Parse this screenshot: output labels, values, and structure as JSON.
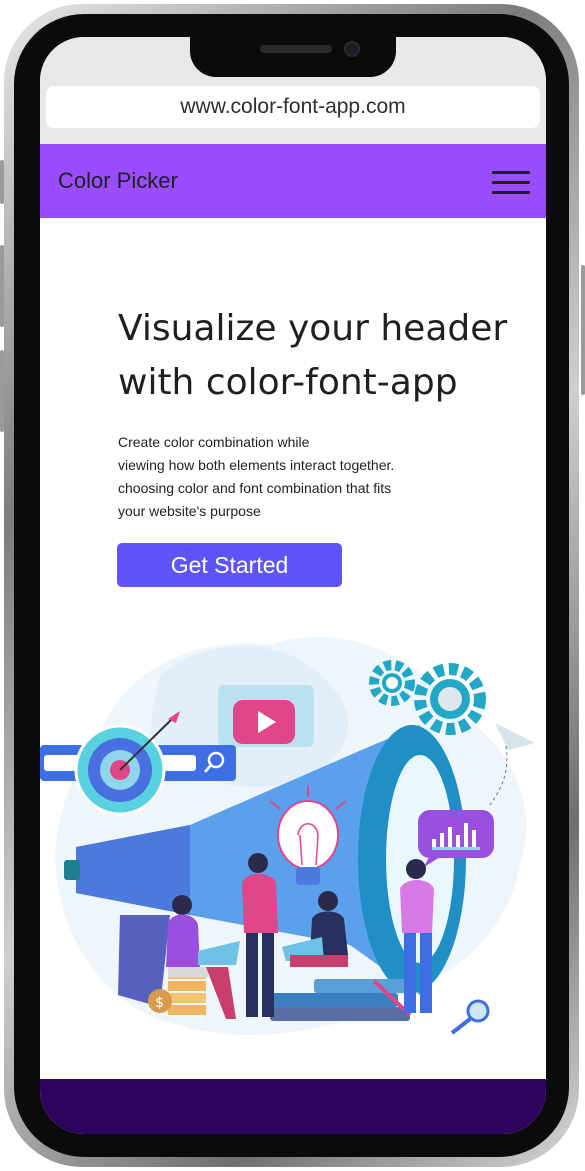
{
  "browser": {
    "url": "www.color-font-app.com"
  },
  "header": {
    "brand": "Color Picker",
    "menu_icon": "hamburger-icon"
  },
  "hero": {
    "title_line1": "Visualize your header",
    "title_line2": "with color-font-app",
    "description": [
      "Create color combination while",
      "viewing how both elements interact together.",
      "choosing color and font combination that fits",
      "your website's purpose"
    ],
    "cta_label": "Get Started"
  },
  "colors": {
    "header": "#9a4dff",
    "cta": "#5e54fa",
    "footer": "#2e035e"
  }
}
